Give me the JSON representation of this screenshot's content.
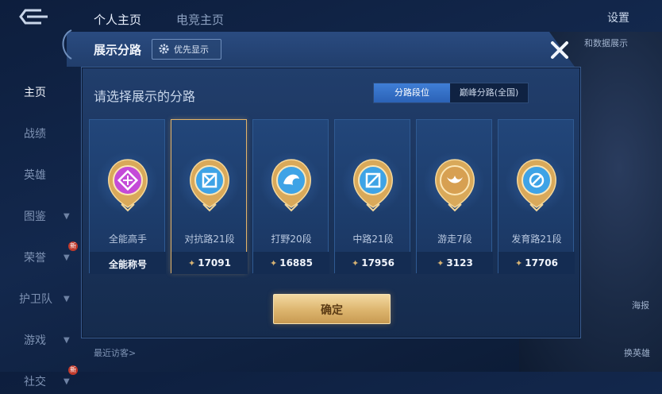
{
  "top_tabs": [
    "个人主页",
    "电竞主页"
  ],
  "settings_label": "设置",
  "sidebar": {
    "items": [
      {
        "label": "主页"
      },
      {
        "label": "战绩"
      },
      {
        "label": "英雄"
      },
      {
        "label": "图鉴"
      },
      {
        "label": "荣誉"
      },
      {
        "label": "护卫队"
      },
      {
        "label": "游戏"
      },
      {
        "label": "社交"
      }
    ],
    "new_badge": "新"
  },
  "background": {
    "right_hint": "和数据展示",
    "poster_label": "海报",
    "change_hero_label": "换英雄",
    "recent_visitors": "最近访客>"
  },
  "modal": {
    "title": "展示分路",
    "priority_button": "优先显示",
    "subtitle": "请选择展示的分路",
    "segment": {
      "options": [
        "分路段位",
        "巅峰分路(全国)"
      ],
      "selected": "分路段位"
    },
    "cards": [
      {
        "name": "全能高手",
        "value": "全能称号",
        "selected": false,
        "show_star": false,
        "color": "#c44bd8"
      },
      {
        "name": "对抗路21段",
        "value": "17091",
        "selected": true,
        "show_star": true,
        "color": "#3ea3e6"
      },
      {
        "name": "打野20段",
        "value": "16885",
        "selected": false,
        "show_star": true,
        "color": "#3ea3e6"
      },
      {
        "name": "中路21段",
        "value": "17956",
        "selected": false,
        "show_star": true,
        "color": "#3ea3e6"
      },
      {
        "name": "游走7段",
        "value": "3123",
        "selected": false,
        "show_star": true,
        "color": "#d7a052"
      },
      {
        "name": "发育路21段",
        "value": "17706",
        "selected": false,
        "show_star": true,
        "color": "#3ea3e6"
      }
    ],
    "confirm_button": "确定"
  }
}
